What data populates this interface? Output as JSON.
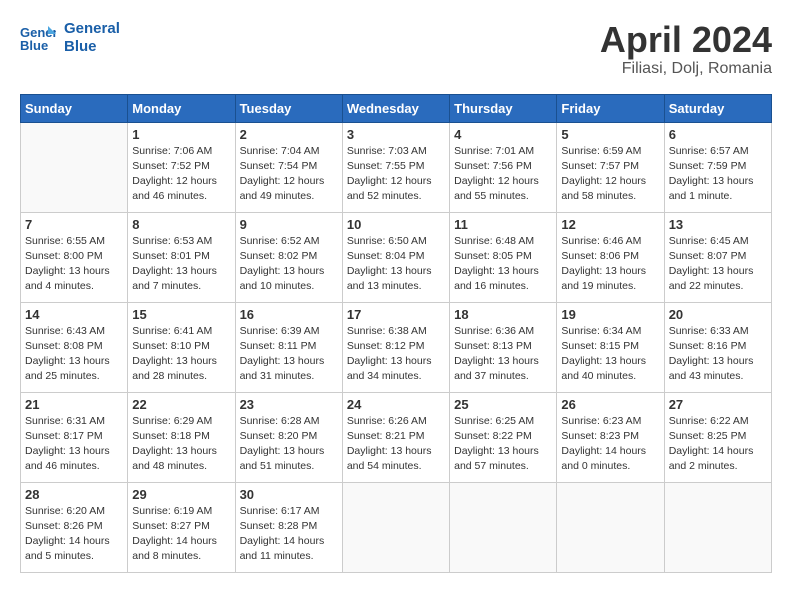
{
  "logo": {
    "line1": "General",
    "line2": "Blue"
  },
  "title": "April 2024",
  "subtitle": "Filiasi, Dolj, Romania",
  "weekdays": [
    "Sunday",
    "Monday",
    "Tuesday",
    "Wednesday",
    "Thursday",
    "Friday",
    "Saturday"
  ],
  "weeks": [
    [
      {
        "day": "",
        "info": ""
      },
      {
        "day": "1",
        "info": "Sunrise: 7:06 AM\nSunset: 7:52 PM\nDaylight: 12 hours\nand 46 minutes."
      },
      {
        "day": "2",
        "info": "Sunrise: 7:04 AM\nSunset: 7:54 PM\nDaylight: 12 hours\nand 49 minutes."
      },
      {
        "day": "3",
        "info": "Sunrise: 7:03 AM\nSunset: 7:55 PM\nDaylight: 12 hours\nand 52 minutes."
      },
      {
        "day": "4",
        "info": "Sunrise: 7:01 AM\nSunset: 7:56 PM\nDaylight: 12 hours\nand 55 minutes."
      },
      {
        "day": "5",
        "info": "Sunrise: 6:59 AM\nSunset: 7:57 PM\nDaylight: 12 hours\nand 58 minutes."
      },
      {
        "day": "6",
        "info": "Sunrise: 6:57 AM\nSunset: 7:59 PM\nDaylight: 13 hours\nand 1 minute."
      }
    ],
    [
      {
        "day": "7",
        "info": "Sunrise: 6:55 AM\nSunset: 8:00 PM\nDaylight: 13 hours\nand 4 minutes."
      },
      {
        "day": "8",
        "info": "Sunrise: 6:53 AM\nSunset: 8:01 PM\nDaylight: 13 hours\nand 7 minutes."
      },
      {
        "day": "9",
        "info": "Sunrise: 6:52 AM\nSunset: 8:02 PM\nDaylight: 13 hours\nand 10 minutes."
      },
      {
        "day": "10",
        "info": "Sunrise: 6:50 AM\nSunset: 8:04 PM\nDaylight: 13 hours\nand 13 minutes."
      },
      {
        "day": "11",
        "info": "Sunrise: 6:48 AM\nSunset: 8:05 PM\nDaylight: 13 hours\nand 16 minutes."
      },
      {
        "day": "12",
        "info": "Sunrise: 6:46 AM\nSunset: 8:06 PM\nDaylight: 13 hours\nand 19 minutes."
      },
      {
        "day": "13",
        "info": "Sunrise: 6:45 AM\nSunset: 8:07 PM\nDaylight: 13 hours\nand 22 minutes."
      }
    ],
    [
      {
        "day": "14",
        "info": "Sunrise: 6:43 AM\nSunset: 8:08 PM\nDaylight: 13 hours\nand 25 minutes."
      },
      {
        "day": "15",
        "info": "Sunrise: 6:41 AM\nSunset: 8:10 PM\nDaylight: 13 hours\nand 28 minutes."
      },
      {
        "day": "16",
        "info": "Sunrise: 6:39 AM\nSunset: 8:11 PM\nDaylight: 13 hours\nand 31 minutes."
      },
      {
        "day": "17",
        "info": "Sunrise: 6:38 AM\nSunset: 8:12 PM\nDaylight: 13 hours\nand 34 minutes."
      },
      {
        "day": "18",
        "info": "Sunrise: 6:36 AM\nSunset: 8:13 PM\nDaylight: 13 hours\nand 37 minutes."
      },
      {
        "day": "19",
        "info": "Sunrise: 6:34 AM\nSunset: 8:15 PM\nDaylight: 13 hours\nand 40 minutes."
      },
      {
        "day": "20",
        "info": "Sunrise: 6:33 AM\nSunset: 8:16 PM\nDaylight: 13 hours\nand 43 minutes."
      }
    ],
    [
      {
        "day": "21",
        "info": "Sunrise: 6:31 AM\nSunset: 8:17 PM\nDaylight: 13 hours\nand 46 minutes."
      },
      {
        "day": "22",
        "info": "Sunrise: 6:29 AM\nSunset: 8:18 PM\nDaylight: 13 hours\nand 48 minutes."
      },
      {
        "day": "23",
        "info": "Sunrise: 6:28 AM\nSunset: 8:20 PM\nDaylight: 13 hours\nand 51 minutes."
      },
      {
        "day": "24",
        "info": "Sunrise: 6:26 AM\nSunset: 8:21 PM\nDaylight: 13 hours\nand 54 minutes."
      },
      {
        "day": "25",
        "info": "Sunrise: 6:25 AM\nSunset: 8:22 PM\nDaylight: 13 hours\nand 57 minutes."
      },
      {
        "day": "26",
        "info": "Sunrise: 6:23 AM\nSunset: 8:23 PM\nDaylight: 14 hours\nand 0 minutes."
      },
      {
        "day": "27",
        "info": "Sunrise: 6:22 AM\nSunset: 8:25 PM\nDaylight: 14 hours\nand 2 minutes."
      }
    ],
    [
      {
        "day": "28",
        "info": "Sunrise: 6:20 AM\nSunset: 8:26 PM\nDaylight: 14 hours\nand 5 minutes."
      },
      {
        "day": "29",
        "info": "Sunrise: 6:19 AM\nSunset: 8:27 PM\nDaylight: 14 hours\nand 8 minutes."
      },
      {
        "day": "30",
        "info": "Sunrise: 6:17 AM\nSunset: 8:28 PM\nDaylight: 14 hours\nand 11 minutes."
      },
      {
        "day": "",
        "info": ""
      },
      {
        "day": "",
        "info": ""
      },
      {
        "day": "",
        "info": ""
      },
      {
        "day": "",
        "info": ""
      }
    ]
  ]
}
